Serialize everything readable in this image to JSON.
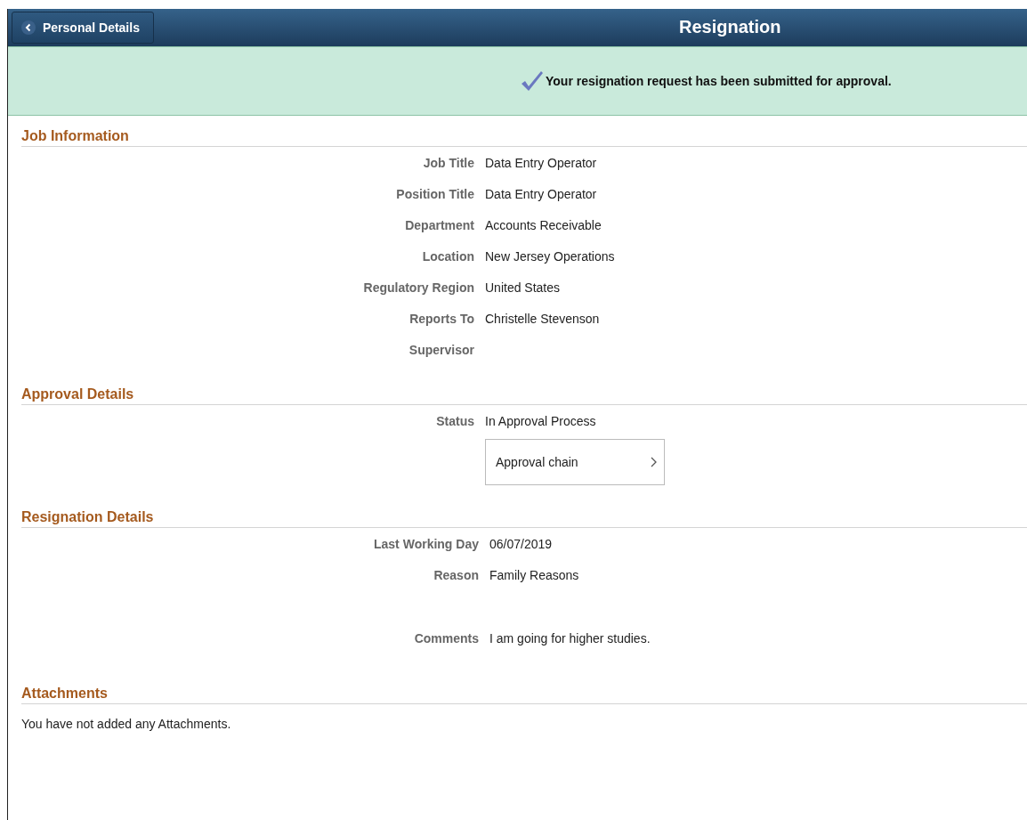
{
  "header": {
    "back_button": "Personal Details",
    "title": "Resignation"
  },
  "banner": {
    "message": "Your resignation request has been submitted for approval."
  },
  "sections": [
    {
      "title": "Job Information",
      "fields": [
        {
          "kind": "text",
          "label": "Job Title",
          "value": "Data Entry Operator"
        },
        {
          "kind": "text",
          "label": "Position Title",
          "value": "Data Entry Operator"
        },
        {
          "kind": "text",
          "label": "Department",
          "value": "Accounts Receivable"
        },
        {
          "kind": "text",
          "label": "Location",
          "value": "New Jersey Operations"
        },
        {
          "kind": "text",
          "label": "Regulatory Region",
          "value": "United States"
        },
        {
          "kind": "text",
          "label": "Reports To",
          "value": "Christelle Stevenson"
        },
        {
          "kind": "text",
          "label": "Supervisor"
        }
      ]
    },
    {
      "title": "Approval Details",
      "fields": [
        {
          "kind": "text",
          "label": "Status",
          "value": "In Approval Process"
        },
        {
          "kind": "link",
          "value": "Approval chain"
        }
      ]
    },
    {
      "title": "Resignation Details",
      "fields": [
        {
          "kind": "text",
          "label": "Last Working Day",
          "value": "06/07/2019"
        },
        {
          "kind": "text",
          "label": "Reason",
          "value": "Family Reasons"
        },
        {
          "kind": "comment",
          "label": "Comments",
          "value": "I am going for higher studies."
        }
      ]
    },
    {
      "title": "Attachments",
      "note": "You have not added any Attachments."
    }
  ]
}
